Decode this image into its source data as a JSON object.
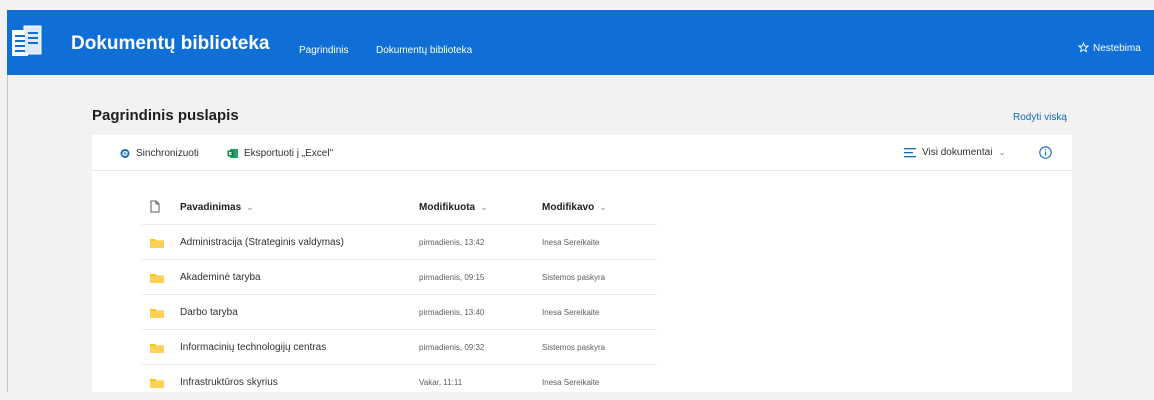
{
  "header": {
    "site_title": "Dokumentų biblioteka",
    "nav": [
      "Pagrindinis",
      "Dokumentų biblioteka"
    ],
    "follow_label": "Nestebima",
    "bg_color": "#0f6fd6"
  },
  "page": {
    "heading": "Pagrindinis puslapis",
    "show_all": "Rodyti viską"
  },
  "commands": {
    "sync": "Sinchronizuoti",
    "export": "Eksportuoti į „Excel\"",
    "view": "Visi dokumentai"
  },
  "columns": {
    "name": "Pavadinimas",
    "modified": "Modifikuota",
    "modified_by": "Modifikavo"
  },
  "rows": [
    {
      "name": "Administracija (Strateginis valdymas)",
      "modified": "pirmadienis, 13:42",
      "modified_by": "Inesa Sereikaite"
    },
    {
      "name": "Akademinė taryba",
      "modified": "pirmadienis, 09:15",
      "modified_by": "Sistemos paskyra"
    },
    {
      "name": "Darbo taryba",
      "modified": "pirmadienis, 13:40",
      "modified_by": "Inesa Sereikaite"
    },
    {
      "name": "Informacinių technologijų centras",
      "modified": "pirmadienis, 09:32",
      "modified_by": "Sistemos paskyra"
    },
    {
      "name": "Infrastruktūros skyrius",
      "modified": "Vakar, 11:11",
      "modified_by": "Inesa Sereikaite"
    }
  ]
}
